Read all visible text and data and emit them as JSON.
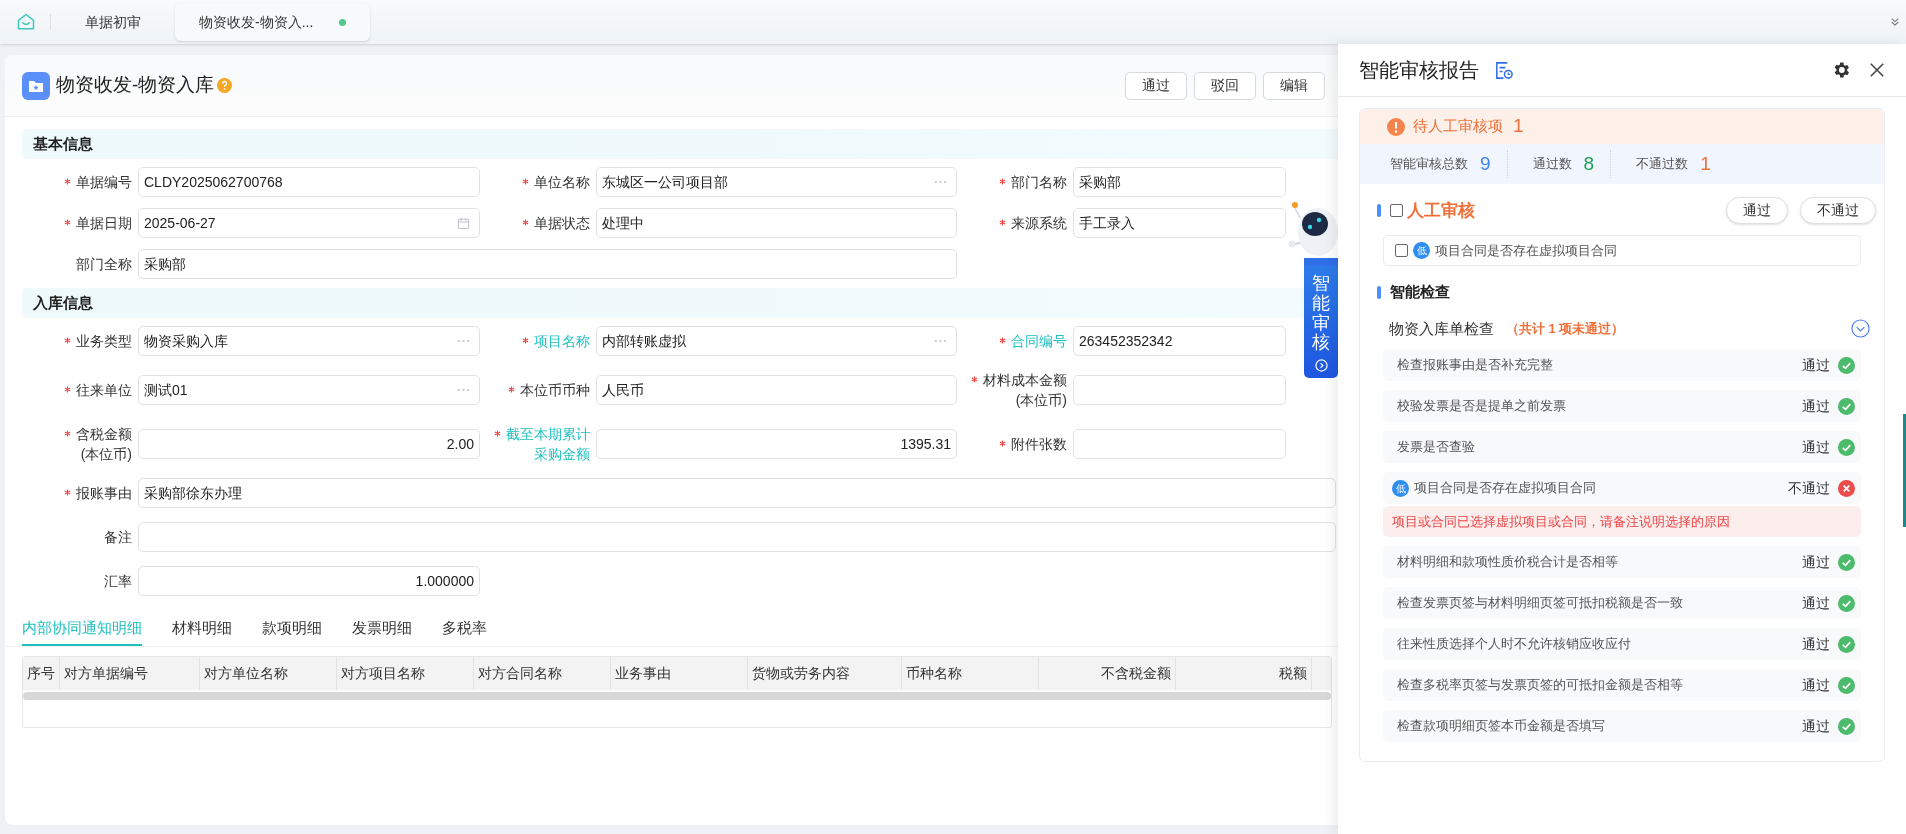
{
  "nav_tabs": [
    {
      "label": "单据初审",
      "selected": false,
      "marked": false
    },
    {
      "label": "物资收发-物资入...",
      "selected": true,
      "marked": true
    }
  ],
  "page": {
    "title": "物资收发-物资入库",
    "buttons": [
      "通过",
      "驳回",
      "编辑"
    ]
  },
  "sections": [
    {
      "title": "基本信息",
      "fields": [
        {
          "label": "单据编号",
          "required": true,
          "value": "CLDY2025062700768",
          "kind": "text"
        },
        {
          "label": "单位名称",
          "required": true,
          "value": "东城区一公司项目部",
          "kind": "lookup"
        },
        {
          "label": "部门名称",
          "required": true,
          "value": "采购部",
          "kind": "text"
        },
        {
          "label": "单据日期",
          "required": true,
          "value": "2025-06-27",
          "kind": "date"
        },
        {
          "label": "单据状态",
          "required": true,
          "value": "处理中",
          "kind": "text"
        },
        {
          "label": "来源系统",
          "required": true,
          "value": "手工录入",
          "kind": "text"
        },
        {
          "label": "部门全称",
          "required": false,
          "value": "采购部",
          "kind": "text"
        }
      ]
    },
    {
      "title": "入库信息",
      "fields": [
        {
          "label": "业务类型",
          "required": true,
          "value": "物资采购入库",
          "kind": "lookup"
        },
        {
          "label": "项目名称",
          "required": true,
          "linked": true,
          "value": "内部转账虚拟",
          "kind": "lookup"
        },
        {
          "label": "合同编号",
          "required": true,
          "linked": true,
          "value": "263452352342",
          "kind": "text"
        },
        {
          "label": "往来单位",
          "required": true,
          "value": "测试01",
          "kind": "lookup"
        },
        {
          "label": "本位币币种",
          "required": true,
          "value": "人民币",
          "kind": "text"
        },
        {
          "label": "材料成本金额",
          "label_2": "(本位币)",
          "required": true,
          "kind": "text"
        },
        {
          "label": "含税金额",
          "label_2": "(本位币)",
          "required": true,
          "value": "2.00",
          "kind": "number"
        },
        {
          "label": "截至本期累计",
          "label_2": "采购金额",
          "required": true,
          "linked": true,
          "value": "1395.31",
          "kind": "number"
        },
        {
          "label": "附件张数",
          "required": true,
          "kind": "text"
        },
        {
          "label": "报账事由",
          "required": true,
          "value": "采购部徐东办理",
          "kind": "text"
        },
        {
          "label": "备注",
          "required": false,
          "kind": "text"
        },
        {
          "label": "汇率",
          "required": false,
          "value": "1.000000",
          "kind": "number"
        }
      ]
    }
  ],
  "detail_tabs": [
    {
      "label": "内部协同通知明细",
      "selected": true
    },
    {
      "label": "材料明细",
      "selected": false
    },
    {
      "label": "款项明细",
      "selected": false
    },
    {
      "label": "发票明细",
      "selected": false
    },
    {
      "label": "多税率",
      "selected": false
    }
  ],
  "table": {
    "columns": [
      {
        "label": "序号"
      },
      {
        "label": "对方单据编号"
      },
      {
        "label": "对方单位名称"
      },
      {
        "label": "对方项目名称"
      },
      {
        "label": "对方合同名称"
      },
      {
        "label": "业务事由"
      },
      {
        "label": "货物或劳务内容"
      },
      {
        "label": "币种名称"
      },
      {
        "label": "不含税金额",
        "numeric": true
      },
      {
        "label": "税额",
        "numeric": true
      }
    ]
  },
  "widget": {
    "label": "智能审核"
  },
  "report": {
    "title": "智能审核报告",
    "alert": {
      "label": "待人工审核项",
      "count": "1"
    },
    "stats": [
      {
        "label": "智能审核总数",
        "value": "9",
        "color": "#3a86f0"
      },
      {
        "label": "通过数",
        "value": "8",
        "color": "#1fa055"
      },
      {
        "label": "不通过数",
        "value": "1",
        "color": "#f0703a"
      }
    ],
    "manual": {
      "title": "人工审核",
      "checked": false,
      "buttons": [
        "通过",
        "不通过"
      ],
      "items": [
        {
          "badge": "低",
          "text": "项目合同是否存在虚拟项目合同",
          "checked": false
        }
      ]
    },
    "smart": {
      "title": "智能检查",
      "group": {
        "title": "物资入库单检查",
        "summary": "（共计 1 项未通过）",
        "expanded": true
      },
      "checks": [
        {
          "text": "检查报账事由是否补充完整",
          "result": "通过",
          "passed": true
        },
        {
          "text": "校验发票是否是提单之前发票",
          "result": "通过",
          "passed": true
        },
        {
          "text": "发票是否查验",
          "result": "通过",
          "passed": true
        },
        {
          "badge": "低",
          "text": "项目合同是否存在虚拟项目合同",
          "result": "不通过",
          "passed": false,
          "message": "项目或合同已选择虚拟项目或合同，请备注说明选择的原因"
        },
        {
          "text": "材料明细和款项性质价税合计是否相等",
          "result": "通过",
          "passed": true
        },
        {
          "text": "检查发票页签与材料明细页签可抵扣税额是否一致",
          "result": "通过",
          "passed": true
        },
        {
          "text": "往来性质选择个人时不允许核销应收应付",
          "result": "通过",
          "passed": true
        },
        {
          "text": "检查多税率页签与发票页签的可抵扣金额是否相等",
          "result": "通过",
          "passed": true
        },
        {
          "text": "检查款项明细页签本币金额是否填写",
          "result": "通过",
          "passed": true
        }
      ]
    }
  }
}
